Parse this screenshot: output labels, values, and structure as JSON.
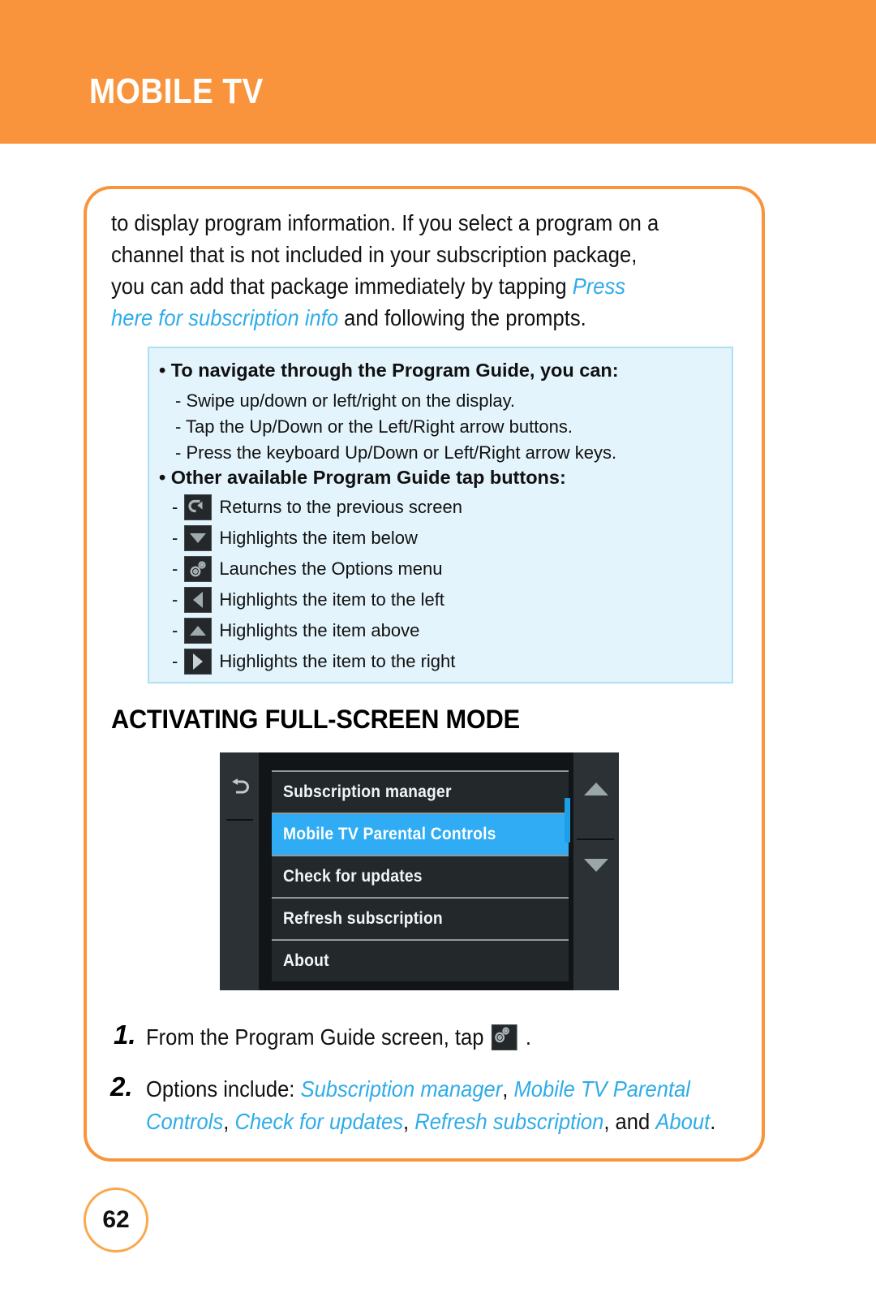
{
  "header": {
    "title": "MOBILE TV"
  },
  "colors": {
    "header_orange": "#F9943C",
    "accent_blue": "#2FACE8",
    "info_box_bg": "#E3F4FC",
    "info_box_border": "#AEDFF3",
    "page_badge_border": "#F9A84C",
    "menu_selected_blue": "#2FACF3"
  },
  "intro": {
    "part1": "to display program information. If you select a program on a channel that is not included in your subscription package, you can add that package immediately by tapping ",
    "link": "Press here for subscription info",
    "part2": " and following the prompts."
  },
  "info_box": {
    "bullet1": "• To navigate through the Program Guide, you can:",
    "sub_items": [
      "- Swipe up/down or left/right on the display.",
      "- Tap the Up/Down or the Left/Right arrow buttons.",
      "- Press the keyboard Up/Down or Left/Right arrow keys."
    ],
    "bullet2": "• Other available Program Guide tap buttons:",
    "button_items": [
      {
        "dash": "-",
        "icon": "back-arrow-icon",
        "label": "Returns to the previous screen"
      },
      {
        "dash": "-",
        "icon": "triangle-down-icon",
        "label": "Highlights the item below"
      },
      {
        "dash": "-",
        "icon": "gears-options-icon",
        "label": "Launches the Options menu"
      },
      {
        "dash": "-",
        "icon": "triangle-left-icon",
        "label": "Highlights the item to the left"
      },
      {
        "dash": "-",
        "icon": "triangle-up-icon",
        "label": "Highlights the item above"
      },
      {
        "dash": "-",
        "icon": "triangle-right-icon",
        "label": "Highlights the item to the right"
      }
    ]
  },
  "section": {
    "heading": "ACTIVATING FULL-SCREEN MODE"
  },
  "phone_screenshot": {
    "back_icon": "back-arrow-icon",
    "scroll_up_icon": "triangle-up-icon",
    "scroll_down_icon": "triangle-down-icon",
    "menu_items": [
      {
        "label": "Subscription manager",
        "selected": false
      },
      {
        "label": "Mobile TV Parental Controls",
        "selected": true
      },
      {
        "label": "Check for updates",
        "selected": false
      },
      {
        "label": "Refresh subscription",
        "selected": false
      },
      {
        "label": "About",
        "selected": false
      }
    ]
  },
  "steps": [
    {
      "number": "1.",
      "text_before": "From the Program Guide screen, tap",
      "icon": "gears-options-icon",
      "text_after": "."
    },
    {
      "number": "2.",
      "lead": "Options include: ",
      "options": [
        "Subscription manager",
        "Mobile TV Parental Controls",
        "Check for updates",
        "Refresh subscription",
        "About"
      ],
      "conjunction": "and",
      "terminator": "."
    }
  ],
  "footer": {
    "page_number": "62"
  }
}
